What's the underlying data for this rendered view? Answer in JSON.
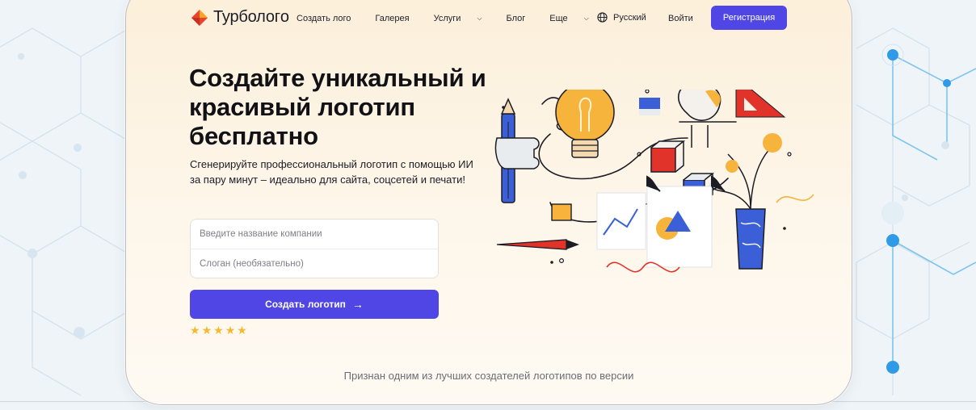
{
  "nav": {
    "brand": "Турбологo",
    "menu": [
      {
        "label": "Создать лого",
        "has_dropdown": false
      },
      {
        "label": "Галерея",
        "has_dropdown": false
      },
      {
        "label": "Услуги",
        "has_dropdown": true
      },
      {
        "label": "Блог",
        "has_dropdown": false
      },
      {
        "label": "Еще",
        "has_dropdown": true
      }
    ],
    "language": "Русский",
    "login": "Войти",
    "register": "Регистрация"
  },
  "hero": {
    "title": "Создайте уникальный и красивый логотип бесплатно",
    "subtitle_line1": "Сгенерируйте профессиональный логотип с помощью ИИ",
    "subtitle_line2": "за пару минут – идеально для сайта, соцсетей и печати!"
  },
  "form": {
    "company_placeholder": "Введите название компании",
    "slogan_placeholder": "Слоган (необязательно)",
    "submit_label": "Создать логотип",
    "submit_arrow": "→"
  },
  "rating": {
    "stars": 5,
    "star_glyph": "★"
  },
  "footer": {
    "recognized_text": "Признан одним из лучших создателей логотипов по версии"
  },
  "colors": {
    "accent": "#4f46e5",
    "logo_red": "#e8452f",
    "logo_orange": "#f5a623",
    "star": "#f5b82e"
  },
  "icons": {
    "logo": "diamond-logo-icon",
    "language": "globe-icon",
    "dropdown": "chevron-down-icon",
    "arrow": "arrow-right-icon"
  }
}
